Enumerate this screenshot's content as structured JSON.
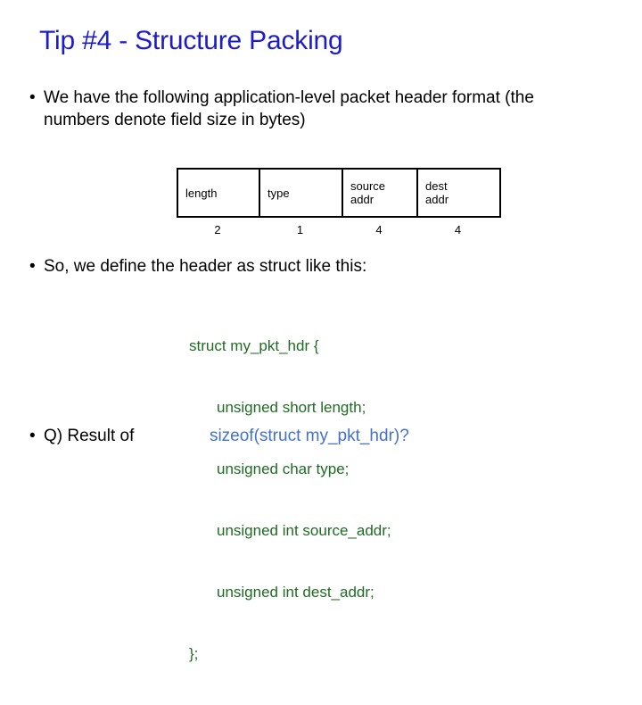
{
  "slide": {
    "title": "Tip #4 - Structure Packing",
    "colors": {
      "title": "#1d1dc8",
      "code_green": "#1f6b23",
      "code_blue": "#4472c4",
      "body": "#000000",
      "background": "#ffffff"
    },
    "bullets": [
      {
        "marker": "•",
        "text": "We have the following application-level packet header format (the numbers denote field size in bytes)"
      },
      {
        "marker": "•",
        "text": "So, we define the header as struct like this:"
      },
      {
        "marker": "•",
        "text_plain": "Q) Result of",
        "text_code": "sizeof(struct my_pkt_hdr)?"
      }
    ],
    "packet_header": {
      "fields": [
        {
          "name_line1": "length",
          "name_line2": "",
          "size": "2"
        },
        {
          "name_line1": "type",
          "name_line2": "",
          "size": "1"
        },
        {
          "name_line1": "source",
          "name_line2": "addr",
          "size": "4"
        },
        {
          "name_line1": "dest",
          "name_line2": "addr",
          "size": "4"
        }
      ]
    },
    "code": {
      "lines": [
        {
          "text": "struct my_pkt_hdr {",
          "indent": false
        },
        {
          "text": "unsigned short length;",
          "indent": true
        },
        {
          "text": "unsigned char type;",
          "indent": true
        },
        {
          "text": "unsigned int source_addr;",
          "indent": true
        },
        {
          "text": "unsigned int dest_addr;",
          "indent": true
        },
        {
          "text": "};",
          "indent": false
        }
      ]
    }
  }
}
